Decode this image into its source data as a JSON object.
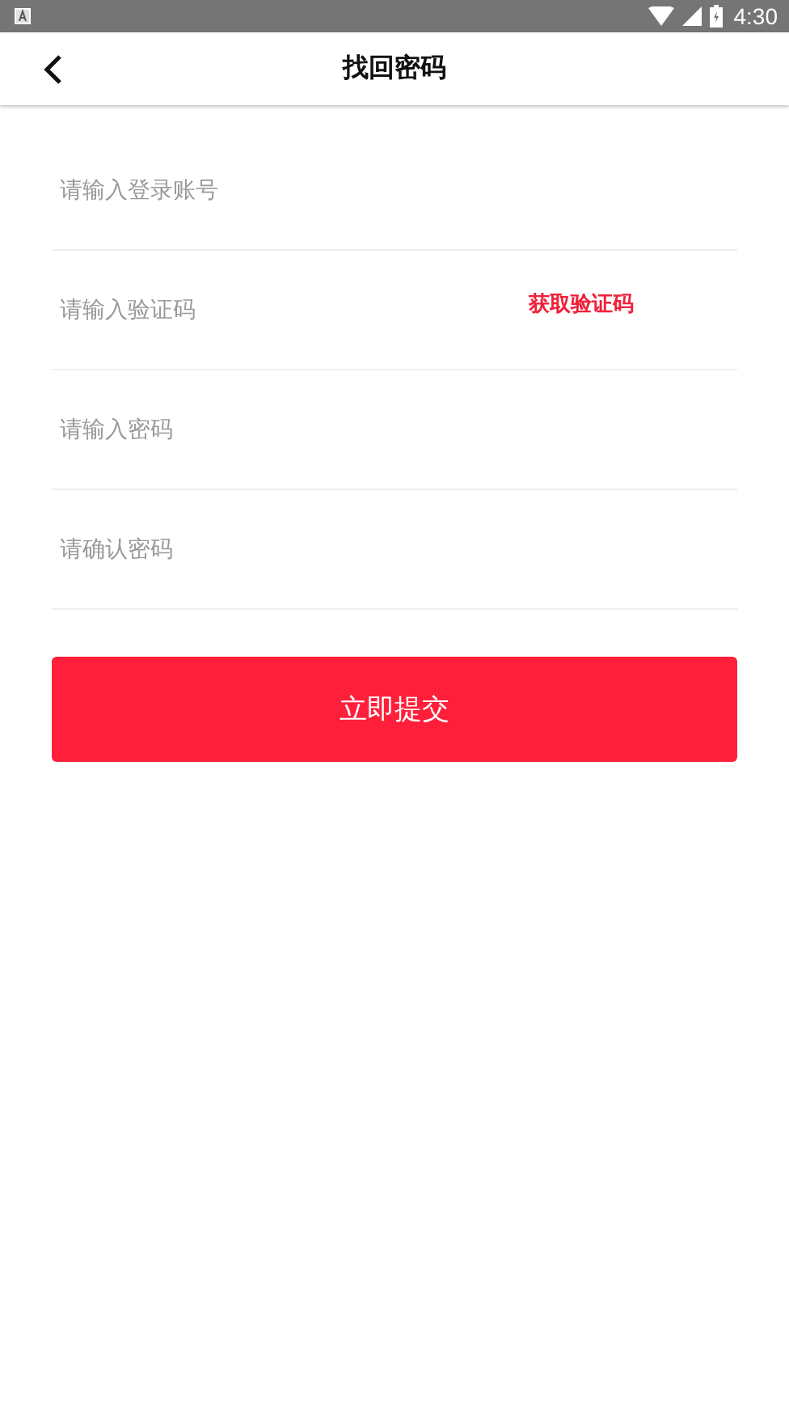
{
  "status_bar": {
    "time": "4:30"
  },
  "header": {
    "title": "找回密码"
  },
  "fields": [
    {
      "kind": "text",
      "placeholder": "请输入登录账号"
    },
    {
      "kind": "code",
      "placeholder": "请输入验证码",
      "action": "获取验证码"
    },
    {
      "kind": "password",
      "placeholder": "请输入密码"
    },
    {
      "kind": "password",
      "placeholder": "请确认密码"
    }
  ],
  "submit": "立即提交"
}
